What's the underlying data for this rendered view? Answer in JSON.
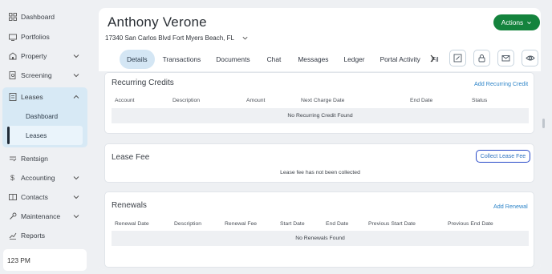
{
  "sidebar": {
    "items": [
      {
        "label": "Dashboard",
        "icon": "dashboard-grid-icon"
      },
      {
        "label": "Portfolios",
        "icon": "portfolio-icon"
      },
      {
        "label": "Property",
        "icon": "property-icon"
      },
      {
        "label": "Screening",
        "icon": "screening-icon"
      },
      {
        "label": "Leases",
        "icon": "lease-document-icon"
      },
      {
        "label": "Rentsign",
        "icon": "rentsign-icon"
      },
      {
        "label": "Accounting",
        "icon": "dollar-icon"
      },
      {
        "label": "Contacts",
        "icon": "contacts-card-icon"
      },
      {
        "label": "Maintenance",
        "icon": "wrench-icon"
      },
      {
        "label": "Reports",
        "icon": "reports-chart-icon"
      }
    ],
    "lease_sub": [
      {
        "label": "Dashboard"
      },
      {
        "label": "Leases"
      }
    ],
    "time": "123 PM"
  },
  "header": {
    "name": "Anthony Verone",
    "address": "17340 San Carlos Blvd Fort Myers Beach, FL",
    "actions_label": "Actions"
  },
  "tabs": [
    {
      "label": "Details"
    },
    {
      "label": "Transactions"
    },
    {
      "label": "Documents"
    },
    {
      "label": "Chat"
    },
    {
      "label": "Messages"
    },
    {
      "label": "Ledger"
    },
    {
      "label": "Portal Activity"
    },
    {
      "label": "Fil"
    }
  ],
  "icon_buttons": [
    "edit-note-icon",
    "lock-icon",
    "mail-icon",
    "eye-icon"
  ],
  "recurring": {
    "title": "Recurring Credits",
    "link": "Add Recurring Credit",
    "columns": [
      "Account",
      "Description",
      "Amount",
      "Next Charge Date",
      "End Date",
      "Status"
    ],
    "empty": "No Recurring Credit Found"
  },
  "lease_fee": {
    "title": "Lease Fee",
    "button": "Collect Lease Fee",
    "message": "Lease fee has not been collected"
  },
  "renewals": {
    "title": "Renewals",
    "link": "Add Renewal",
    "columns": [
      "Renewal Date",
      "Description",
      "Renewal Fee",
      "Start Date",
      "End Date",
      "Previous Start Date",
      "Previous End Date"
    ],
    "empty": "No Renewals Found"
  },
  "colors": {
    "accent_green": "#14833d",
    "active_tab": "#d4e6f4",
    "link_blue": "#2d84c8"
  }
}
